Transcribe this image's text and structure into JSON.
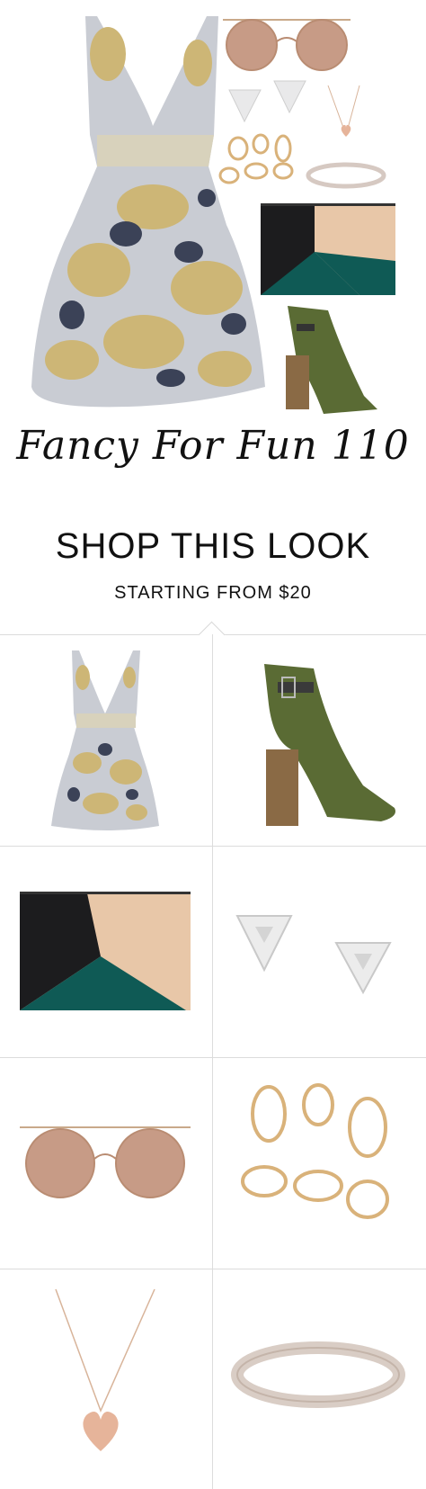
{
  "collage": {
    "title": "Fancy For Fun 110"
  },
  "shop": {
    "title": "SHOP THIS LOOK",
    "subtitle": "STARTING FROM $20"
  },
  "products": [
    {
      "name": "dress"
    },
    {
      "name": "green-peep-toe-bootie"
    },
    {
      "name": "color-block-clutch"
    },
    {
      "name": "triangle-stud-earrings"
    },
    {
      "name": "mirrored-round-sunglasses"
    },
    {
      "name": "gold-ring-set"
    },
    {
      "name": "heart-pendant-necklace"
    },
    {
      "name": "love-bangle-bracelet"
    }
  ],
  "colors": {
    "dress_base": "#c9ccd3",
    "dress_gold": "#cdb676",
    "dress_navy": "#3b4257",
    "shoe_green": "#5a6b34",
    "heel_brown": "#8a6a45",
    "clutch_black": "#1c1c1e",
    "clutch_teal": "#0f5a55",
    "clutch_tan": "#e8c7a8",
    "gold": "#d9b27a",
    "rose_gold": "#e6b49a",
    "lens": "#c79b86"
  }
}
